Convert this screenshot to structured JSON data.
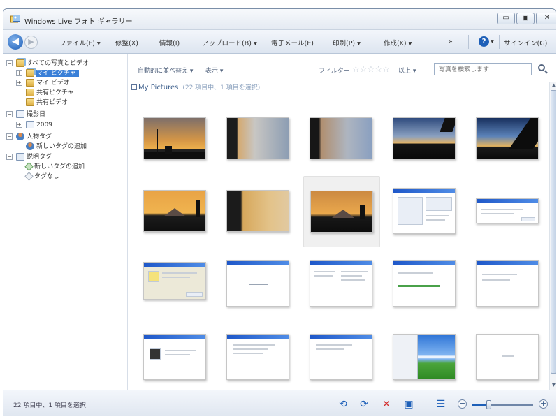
{
  "window": {
    "title": "Windows Live フォト ギャラリー",
    "caption_minimize": "▭",
    "caption_maximize": "▣",
    "caption_close": "✕"
  },
  "menu": {
    "back": "◀",
    "forward": "▶",
    "items": [
      {
        "label": "ファイル(F) ▾",
        "name": "menu-file"
      },
      {
        "label": "修整(X)",
        "name": "menu-fix"
      },
      {
        "label": "情報(I)",
        "name": "menu-info"
      },
      {
        "label": "アップロード(B) ▾",
        "name": "menu-upload"
      },
      {
        "label": "電子メール(E)",
        "name": "menu-email"
      },
      {
        "label": "印刷(P) ▾",
        "name": "menu-print"
      },
      {
        "label": "作成(K) ▾",
        "name": "menu-make"
      },
      {
        "label": "»",
        "name": "menu-overflow"
      },
      {
        "label": "▾",
        "name": "menu-help-dropdown"
      },
      {
        "label": "サインイン(G)",
        "name": "menu-signin"
      }
    ],
    "help": "?"
  },
  "tree": {
    "items": [
      {
        "label": "すべての写真とビデオ",
        "expander": "⊟"
      },
      {
        "label": "マイ ピクチャ",
        "expander": "⊞",
        "selected": true
      },
      {
        "label": "マイ ビデオ",
        "expander": "⊞"
      },
      {
        "label": "共有ピクチャ"
      },
      {
        "label": "共有ビデオ"
      },
      {
        "label": "撮影日",
        "expander": "⊟"
      },
      {
        "label": "2009",
        "expander": "⊞"
      },
      {
        "label": "人物タグ",
        "expander": "⊟"
      },
      {
        "label": "新しいタグの追加"
      },
      {
        "label": "説明タグ",
        "expander": "⊟"
      },
      {
        "label": "新しいタグの追加"
      },
      {
        "label": "タグなし"
      }
    ]
  },
  "toolbar": {
    "sort": "自動的に並べ替え ▾",
    "display": "表示 ▾",
    "filter": "フィルター",
    "stars": "☆☆☆☆☆",
    "filter_range": "以上 ▾",
    "search_placeholder": "写真を検索します"
  },
  "breadcrumb": {
    "folder": "My Pictures",
    "count": "(22 項目中、1 項目を選択)"
  },
  "status": {
    "text": "22 項目中、1 項目を選択",
    "rotate_left": "⟲",
    "rotate_right": "⟳",
    "delete": "✕",
    "slideshow": "▣",
    "details": "☰",
    "zoom_out": "−",
    "zoom_in": "+",
    "zoom_level": 0.28
  },
  "scrollbar": {
    "up": "▲",
    "down": "▼"
  },
  "colors": {
    "selection": "#3a80d8",
    "accent": "#1d5fb8",
    "delete": "#d32f2f"
  }
}
